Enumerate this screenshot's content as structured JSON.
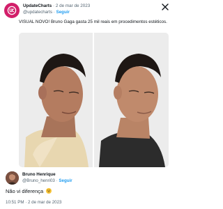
{
  "tweet": {
    "author_name": "UpdateCharts",
    "date": "2 de mar de 2023",
    "handle": "@updatecharts",
    "follow_label": "Seguir",
    "separator": "·",
    "text": "VISUAL NOVO! Bruno Gaga gasta 25 mil reais em procedimentos estéticos."
  },
  "reply": {
    "author_name": "Bruno Henrique",
    "handle": "@Bruno_henri03",
    "follow_label": "Seguir",
    "separator": "·",
    "text": "Não vi diferença",
    "emoji": "grinning-face-emoji",
    "timestamp": "10:51 PM · 2 de mar de 2023"
  },
  "colors": {
    "brand_avatar": "#d21f6a",
    "link": "#1d9bf0",
    "secondary_text": "#536471"
  }
}
